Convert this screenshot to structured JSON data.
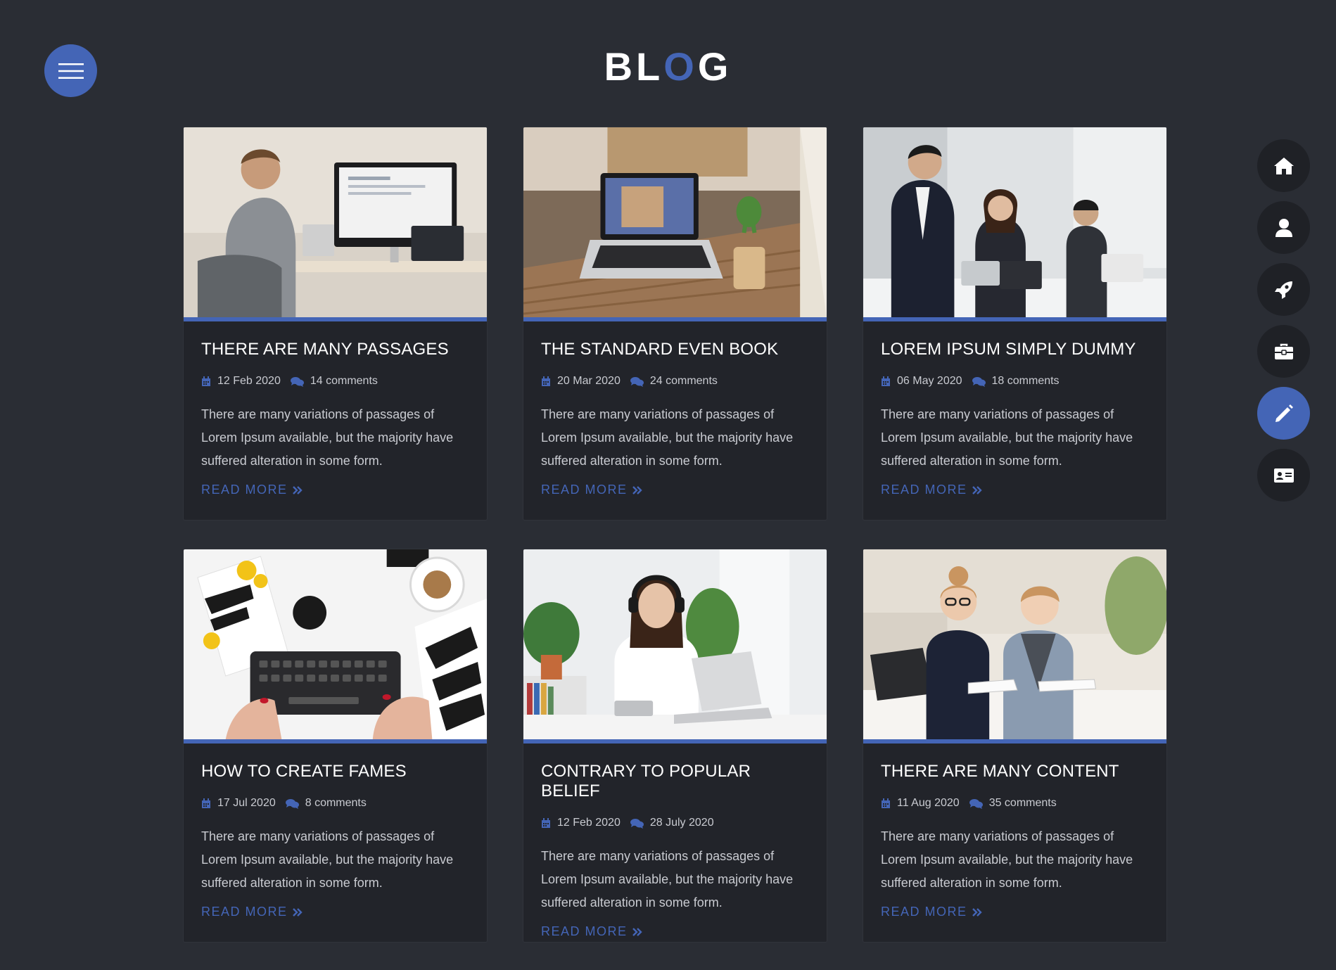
{
  "header": {
    "title_before": "BL",
    "title_accent": "O",
    "title_after": "G",
    "menu_icon": "hamburger-icon"
  },
  "colors": {
    "accent": "#4465b6",
    "background": "#2a2d34",
    "card": "#22242a",
    "nav_button": "#1f2126"
  },
  "side_nav": [
    {
      "icon": "home-icon",
      "active": false
    },
    {
      "icon": "user-icon",
      "active": false
    },
    {
      "icon": "rocket-icon",
      "active": false
    },
    {
      "icon": "briefcase-icon",
      "active": false
    },
    {
      "icon": "pencil-icon",
      "active": true
    },
    {
      "icon": "contact-card-icon",
      "active": false
    }
  ],
  "posts": [
    {
      "image": "man-coding-at-desk-photo",
      "title": "THERE ARE MANY PASSAGES",
      "date": "12 Feb 2020",
      "comments": "14 comments",
      "excerpt": "There are many variations of passages of Lorem Ipsum available, but the majority have suffered alteration in some form.",
      "read_more": "READ MORE"
    },
    {
      "image": "laptop-on-cafe-table-photo",
      "title": "THE STANDARD EVEN BOOK",
      "date": "20 Mar 2020",
      "comments": "24 comments",
      "excerpt": "There are many variations of passages of Lorem Ipsum available, but the majority have suffered alteration in some form.",
      "read_more": "READ MORE"
    },
    {
      "image": "office-team-headsets-photo",
      "title": "LOREM IPSUM SIMPLY DUMMY",
      "date": "06 May 2020",
      "comments": "18 comments",
      "excerpt": "There are many variations of passages of Lorem Ipsum available, but the majority have suffered alteration in some form.",
      "read_more": "READ MORE"
    },
    {
      "image": "keyboard-creative-mess-photo",
      "title": "HOW TO CREATE FAMES",
      "date": "17 Jul 2020",
      "comments": "8 comments",
      "excerpt": "There are many variations of passages of Lorem Ipsum available, but the majority have suffered alteration in some form.",
      "read_more": "READ MORE"
    },
    {
      "image": "woman-with-headphones-laptop-photo",
      "title": "CONTRARY TO POPULAR BELIEF",
      "date": "12 Feb 2020",
      "comments": "28 July 2020",
      "excerpt": "There are many variations of passages of Lorem Ipsum available, but the majority have suffered alteration in some form.",
      "read_more": "READ MORE"
    },
    {
      "image": "children-studying-photo",
      "title": "THERE ARE MANY CONTENT",
      "date": "11 Aug 2020",
      "comments": "35 comments",
      "excerpt": "There are many variations of passages of Lorem Ipsum available, but the majority have suffered alteration in some form.",
      "read_more": "READ MORE"
    }
  ]
}
